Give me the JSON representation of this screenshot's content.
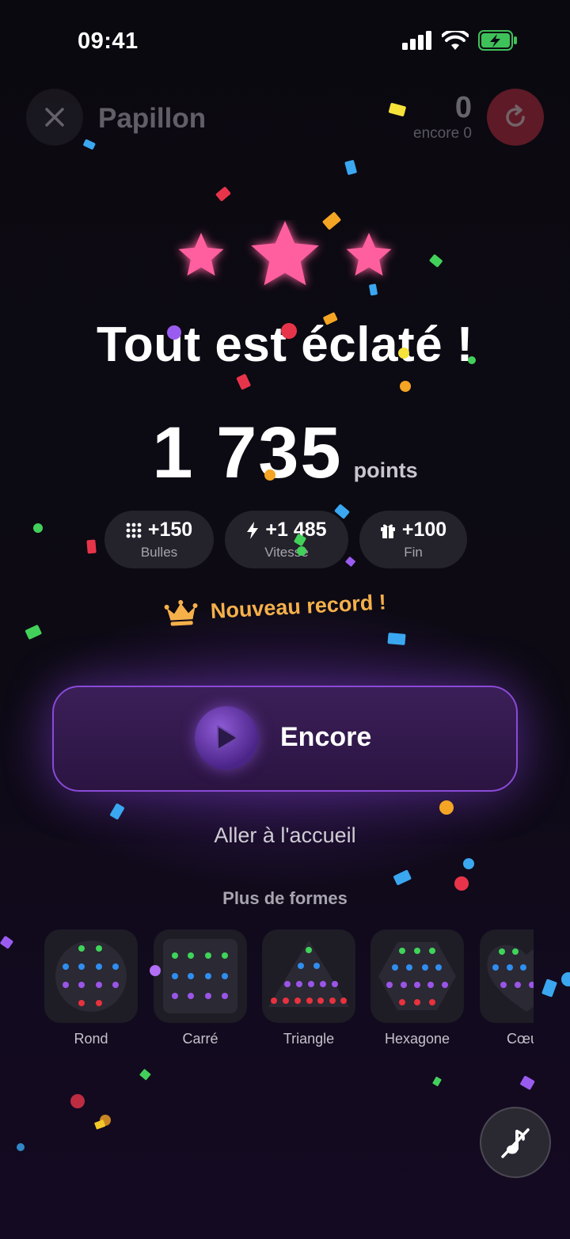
{
  "status_bar": {
    "time": "09:41"
  },
  "header": {
    "level_name": "Papillon",
    "score": "0",
    "score_sub": "encore 0"
  },
  "result": {
    "stars_earned": 3,
    "headline": "Tout est éclaté !",
    "score": "1 735",
    "score_unit": "points"
  },
  "bonuses": [
    {
      "icon": "bubbles-grid-icon",
      "value": "+150",
      "label": "Bulles"
    },
    {
      "icon": "lightning-icon",
      "value": "+1 485",
      "label": "Vitesse"
    },
    {
      "icon": "gift-icon",
      "value": "+100",
      "label": "Fin"
    }
  ],
  "record": {
    "icon": "crown-icon",
    "label": "Nouveau record !"
  },
  "actions": {
    "play_again_label": "Encore",
    "home_label": "Aller à l'accueil"
  },
  "more_shapes": {
    "heading": "Plus de formes",
    "items": [
      {
        "label": "Rond"
      },
      {
        "label": "Carré"
      },
      {
        "label": "Triangle"
      },
      {
        "label": "Hexagone"
      },
      {
        "label": "Cœur"
      }
    ]
  },
  "colors": {
    "background": "#0b0812",
    "star": "#ff5f9e",
    "accent_purple": "#8a4ad6",
    "record": "#f5b04a",
    "restart": "#c43040",
    "pill": "#24222b"
  },
  "icons": {
    "close": "close-icon",
    "restart": "restart-icon",
    "play": "play-icon",
    "sound": "sound-muted-icon"
  }
}
